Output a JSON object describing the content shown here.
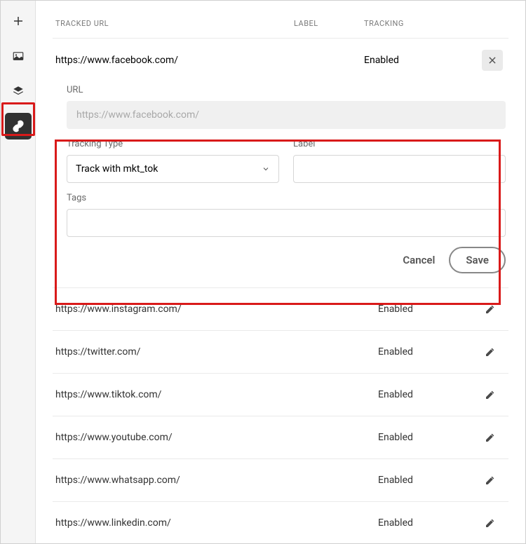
{
  "headers": {
    "tracked_url": "TRACKED URL",
    "label": "LABEL",
    "tracking": "TRACKING"
  },
  "expanded": {
    "url": "https://www.facebook.com/",
    "tracking": "Enabled",
    "url_label": "URL",
    "url_value": "https://www.facebook.com/",
    "tracking_type_label": "Tracking Type",
    "tracking_type_value": "Track with mkt_tok",
    "label_label": "Label",
    "label_value": "",
    "tags_label": "Tags",
    "tags_value": "",
    "cancel": "Cancel",
    "save": "Save"
  },
  "rows": [
    {
      "url": "https://www.instagram.com/",
      "tracking": "Enabled"
    },
    {
      "url": "https://twitter.com/",
      "tracking": "Enabled"
    },
    {
      "url": "https://www.tiktok.com/",
      "tracking": "Enabled"
    },
    {
      "url": "https://www.youtube.com/",
      "tracking": "Enabled"
    },
    {
      "url": "https://www.whatsapp.com/",
      "tracking": "Enabled"
    },
    {
      "url": "https://www.linkedin.com/",
      "tracking": "Enabled"
    }
  ]
}
